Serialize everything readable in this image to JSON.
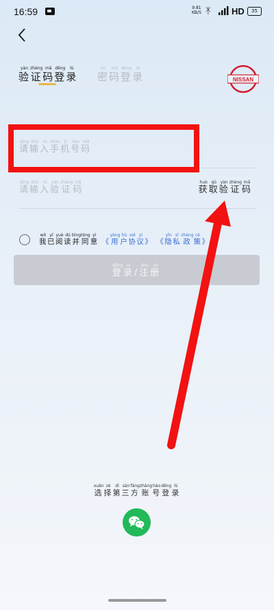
{
  "status_bar": {
    "time": "16:59",
    "net_speed_value": "9.81",
    "net_speed_unit": "KB/S",
    "network": "HD",
    "battery": "35"
  },
  "tabs": {
    "code_login": {
      "label": "验证码登录",
      "pinyin": [
        "yàn",
        "zhèng",
        "mǎ",
        "dēng",
        "lù"
      ]
    },
    "password_login": {
      "label": "密码登录",
      "pinyin": [
        "mì",
        "mǎ",
        "dēng",
        "lù"
      ]
    }
  },
  "brand": {
    "logo_text": "NISSAN",
    "color": "#d1202f"
  },
  "phone_field": {
    "placeholder": "请输入手机号码",
    "pinyin": [
      "qǐng",
      "shū",
      "rù",
      "shǒu",
      "jī",
      "hào",
      "mǎ"
    ]
  },
  "code_field": {
    "placeholder": "请输入验证码",
    "pinyin": [
      "qǐng",
      "shū",
      "rù",
      "yàn",
      "zhèng",
      "mǎ"
    ]
  },
  "get_code": {
    "label": "获取验证码",
    "pinyin": [
      "huò",
      "qǔ",
      "yàn",
      "zhèng",
      "mǎ"
    ]
  },
  "agreement": {
    "prefix": "我已阅读并同意",
    "prefix_pinyin": [
      "wǒ",
      "yǐ",
      "yuè",
      "dú",
      "bìng",
      "tóng",
      "yì"
    ],
    "user_agreement": "《用户协议》",
    "user_agreement_pinyin": [
      "",
      "yòng",
      "hù",
      "xié",
      "yì",
      ""
    ],
    "privacy_policy": "《隐私政策》",
    "privacy_policy_pinyin": [
      "",
      "yǐn",
      "sī",
      "zhèng",
      "cè",
      ""
    ]
  },
  "login_button": {
    "label": "登录/注册",
    "pinyin": [
      "dēng",
      "lù",
      "",
      "zhù",
      "cè"
    ]
  },
  "third_party": {
    "label": "选择第三方账号登录",
    "pinyin": [
      "xuǎn",
      "zé",
      "dì",
      "sān",
      "fāng",
      "zhàng",
      "hào",
      "dēng",
      "lù"
    ]
  },
  "colors": {
    "annotation_red": "#f21212",
    "wechat_green": "#22b95a",
    "link_blue": "#3a6fd8",
    "tab_underline": "#e6b84a"
  }
}
